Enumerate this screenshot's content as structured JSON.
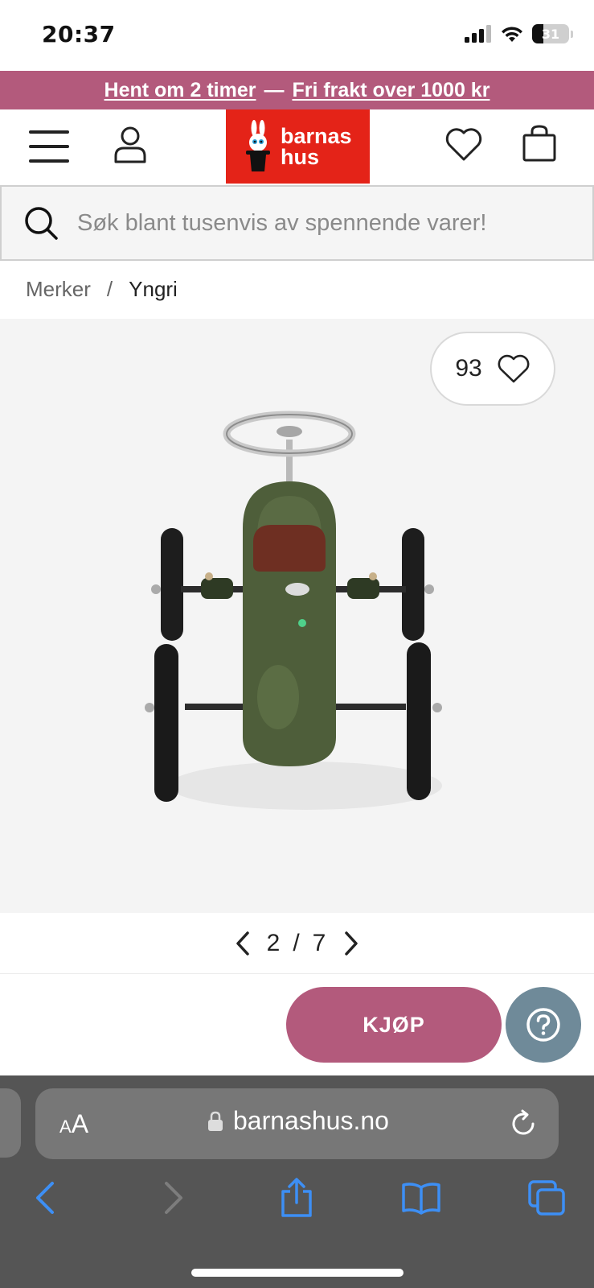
{
  "status_bar": {
    "time": "20:37",
    "battery": "31"
  },
  "promo": {
    "pickup": "Hent om 2 timer",
    "separator": "—",
    "shipping": "Fri frakt over 1000 kr"
  },
  "header": {
    "logo_line1": "barnas",
    "logo_line2": "hus",
    "brand_color": "#e42318",
    "accent_color": "#b35a7c"
  },
  "search": {
    "placeholder": "Søk blant tusenvis av spennende varer!"
  },
  "breadcrumb": {
    "parent": "Merker",
    "separator": "/",
    "current": "Yngri"
  },
  "gallery": {
    "likes": "93",
    "current": "2",
    "separator": "/",
    "total": "7"
  },
  "actions": {
    "buy_label": "KJØP"
  },
  "browser": {
    "aa_small": "A",
    "aa_big": "A",
    "url": "barnashus.no"
  }
}
